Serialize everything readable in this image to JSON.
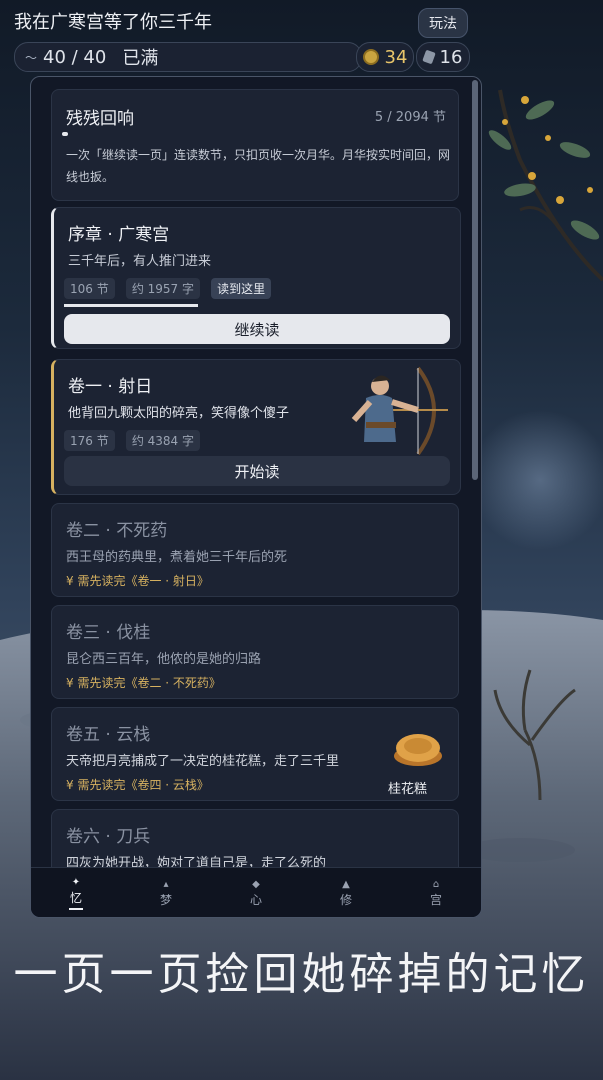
{
  "header": {
    "title": "我在广寒宫等了你三千年",
    "rules_label": "玩法",
    "energy_value": "40 / 40",
    "energy_status": "已满",
    "coins": "34",
    "gems": "16"
  },
  "summary": {
    "title": "残残回响",
    "progress": "5 / 2094 节",
    "progress_fraction": 0.0024,
    "desc": "一次「继续读一页」连读数节，只扣页收一次月华。月华按实时间回，网线也扳。"
  },
  "cards": [
    {
      "title": "序章 · 广寒宫",
      "desc": "三千年后，有人推门进来",
      "tag1": "106 节",
      "tag2": "约 1957 字",
      "tag3": "读到这里",
      "button": "继续读",
      "progress_fraction": 0.35
    },
    {
      "title": "卷一 · 射日",
      "desc": "他背回九颗太阳的碎亮，笑得像个傻子",
      "tag1": "176 节",
      "tag2": "约 4384 字",
      "button": "开始读"
    },
    {
      "title": "卷二 · 不死药",
      "desc": "西王母的药典里，煮着她三千年后的死",
      "lock": "¥   需先读完《卷一 · 射日》"
    },
    {
      "title": "卷三 · 伐桂",
      "desc": "昆仑西三百年，他侬的是她的归路",
      "lock": "¥   需先读完《卷二 · 不死药》"
    },
    {
      "title": "卷五 · 云栈",
      "desc": "天帝把月亮捕成了一决定的桂花糕，走了三千里",
      "lock": "¥   需先读完《卷四 · 云栈》",
      "item_label": "桂花糕"
    },
    {
      "title": "卷六 · 刀兵",
      "desc": "四灰为她开战，姁对了道自己是，走了么死的"
    }
  ],
  "nav": [
    "忆",
    "梦",
    "心",
    "修",
    "宫"
  ],
  "slogan": "一页一页捡回她碎掉的记忆",
  "colors": {
    "accent_gold": "#d6b160",
    "panel_bg": "#121826",
    "card_bg": "#1c2333"
  }
}
